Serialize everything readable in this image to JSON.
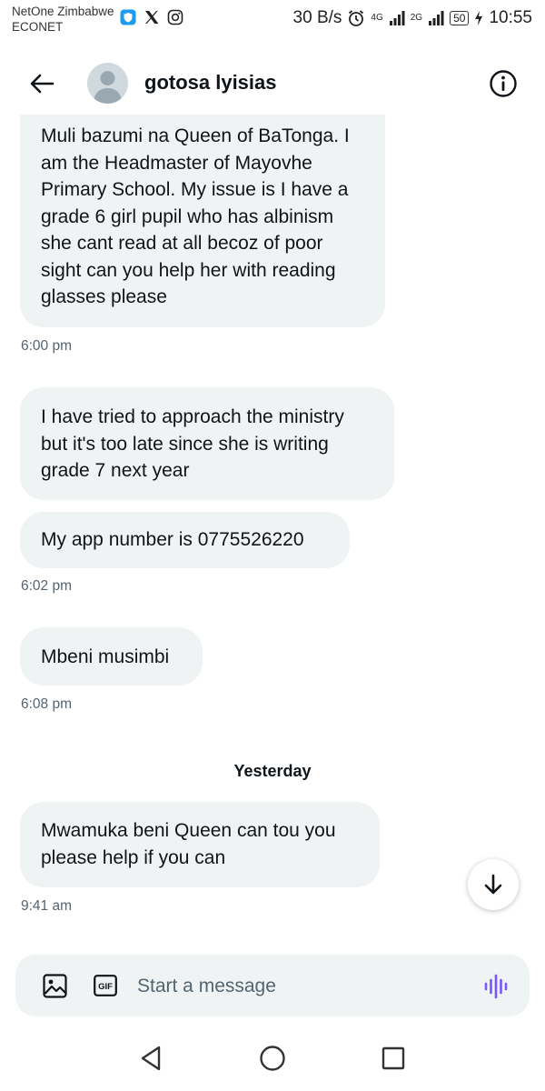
{
  "status_bar": {
    "carrier_primary": "NetOne Zimbabwe",
    "carrier_secondary": "ECONET",
    "net_speed": "30 B/s",
    "sim1_type": "4G",
    "sim2_type": "2G",
    "battery": "50",
    "time": "10:55"
  },
  "header": {
    "title": "gotosa lyisias"
  },
  "messages": [
    {
      "text": "Muli bazumi na Queen of BaTonga. I am the Headmaster of Mayovhe Primary School. My issue is I have a grade 6 girl pupil who has albinism she cant read at all becoz of poor sight can you help her with reading glasses please"
    },
    {
      "text": "I have tried to approach the ministry but it's too late since she is writing grade 7 next year"
    },
    {
      "text": "My app number is 0775526220"
    },
    {
      "text": "Mbeni musimbi"
    },
    {
      "text": "Mwamuka beni Queen can tou you please help if you can"
    }
  ],
  "timestamps": [
    "6:00 pm",
    "6:02 pm",
    "6:08 pm",
    "9:41 am"
  ],
  "day_separator": "Yesterday",
  "composer": {
    "placeholder": "Start a message",
    "gif_label": "GIF"
  },
  "colors": {
    "bubble_bg": "#eff3f4",
    "text": "#0f1419",
    "muted": "#536471",
    "voice_accent": "#7856ff"
  },
  "icons": [
    "back-arrow-icon",
    "avatar",
    "info-icon",
    "scroll-down-arrow-icon",
    "image-icon",
    "gif-icon",
    "voice-wave-icon",
    "nav-back-icon",
    "nav-home-icon",
    "nav-recents-icon"
  ]
}
